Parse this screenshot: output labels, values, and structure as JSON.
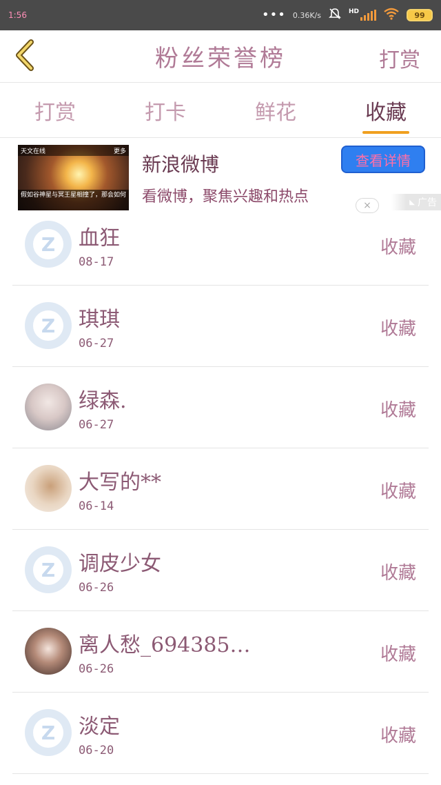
{
  "status_bar": {
    "left_text": "1:56",
    "net_speed": "0.36K/s",
    "network_label": "HD",
    "battery": "99"
  },
  "header": {
    "back_icon": "chevron-left-icon",
    "title": "粉丝荣誉榜",
    "right_action": "打赏"
  },
  "tabs": [
    {
      "label": "打赏",
      "active": false
    },
    {
      "label": "打卡",
      "active": false
    },
    {
      "label": "鲜花",
      "active": false
    },
    {
      "label": "收藏",
      "active": true
    }
  ],
  "ad": {
    "thumb_source": "天文在线",
    "thumb_more": "更多",
    "thumb_caption": "假如谷神星与冥王星相撞了，那会如何",
    "title": "新浪微博",
    "description": "看微博，聚焦兴趣和热点",
    "button": "查看详情",
    "close": "×",
    "tag": "广告"
  },
  "list": [
    {
      "name": "血狂",
      "date": "08-17",
      "action": "收藏",
      "avatar": "default"
    },
    {
      "name": "琪琪",
      "date": "06-27",
      "action": "收藏",
      "avatar": "default"
    },
    {
      "name": "绿森.",
      "date": "06-27",
      "action": "收藏",
      "avatar": "photo-a"
    },
    {
      "name": "大写的**",
      "date": "06-14",
      "action": "收藏",
      "avatar": "photo-b"
    },
    {
      "name": "调皮少女",
      "date": "06-26",
      "action": "收藏",
      "avatar": "default"
    },
    {
      "name": "离人愁_694385…",
      "date": "06-26",
      "action": "收藏",
      "avatar": "photo-c"
    },
    {
      "name": "淡定",
      "date": "06-20",
      "action": "收藏",
      "avatar": "default"
    }
  ]
}
